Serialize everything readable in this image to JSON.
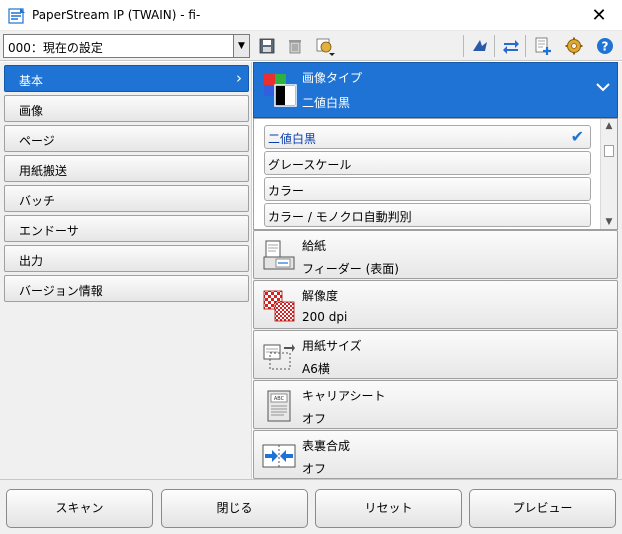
{
  "window": {
    "title": "PaperStream IP (TWAIN) - fi-",
    "close_glyph": "✕"
  },
  "toolbar": {
    "profile_value": "000：現在の設定",
    "icons": [
      "save-icon",
      "delete-icon",
      "profile-manage-icon",
      "scan-direction-icon",
      "swap-icon",
      "add-profile-icon",
      "settings-gear-icon",
      "help-icon"
    ]
  },
  "nav": {
    "items": [
      {
        "label": "基本",
        "active": true
      },
      {
        "label": "画像",
        "active": false
      },
      {
        "label": "ページ",
        "active": false
      },
      {
        "label": "用紙搬送",
        "active": false
      },
      {
        "label": "バッチ",
        "active": false
      },
      {
        "label": "エンドーサ",
        "active": false
      },
      {
        "label": "出力",
        "active": false
      },
      {
        "label": "バージョン情報",
        "active": false
      }
    ]
  },
  "image_type": {
    "title": "画像タイプ",
    "value": "二値白黒",
    "options": [
      {
        "label": "二値白黒",
        "selected": true
      },
      {
        "label": "グレースケール",
        "selected": false
      },
      {
        "label": "カラー",
        "selected": false
      },
      {
        "label": "カラー / モノクロ自動判別",
        "selected": false
      }
    ]
  },
  "settings": [
    {
      "title": "給紙",
      "value": "フィーダー (表面)",
      "icon": "feeder-icon"
    },
    {
      "title": "解像度",
      "value": "200 dpi",
      "icon": "resolution-icon"
    },
    {
      "title": "用紙サイズ",
      "value": "A6横",
      "icon": "paper-size-icon"
    },
    {
      "title": "キャリアシート",
      "value": "オフ",
      "icon": "carrier-sheet-icon"
    },
    {
      "title": "表裏合成",
      "value": "オフ",
      "icon": "merge-sides-icon"
    }
  ],
  "buttons": {
    "scan": "スキャン",
    "close": "閉じる",
    "reset": "リセット",
    "preview": "プレビュー"
  },
  "colors": {
    "accent": "#1e73d4",
    "panel": "#f0f0f0"
  }
}
